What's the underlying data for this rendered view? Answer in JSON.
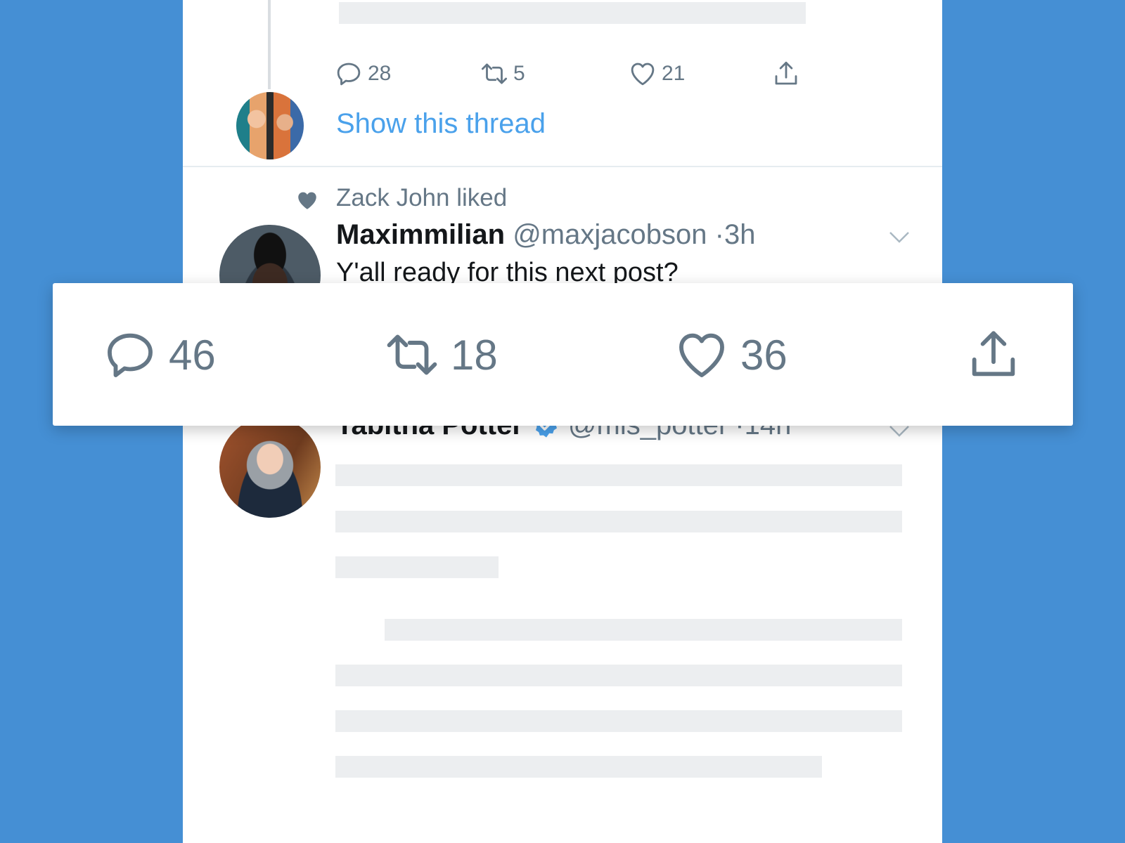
{
  "prev_tweet": {
    "actions": {
      "reply_count": "28",
      "retweet_count": "5",
      "like_count": "21"
    },
    "show_thread": "Show this thread"
  },
  "liked_tweet": {
    "social_context": "Zack John liked",
    "author_name": "Maximmilian",
    "handle": "@maxjacobson",
    "time": "·3h",
    "text": "Y'all ready for this next post?"
  },
  "action_bar": {
    "reply_count": "46",
    "retweet_count": "18",
    "like_count": "36"
  },
  "next_tweet": {
    "author_name": "Tabitha Potter",
    "handle": "@mis_potter",
    "time": "·14h"
  },
  "colors": {
    "background": "#458fd4",
    "link": "#4aa1eb",
    "muted": "#657786",
    "verified": "#4aa1eb"
  },
  "icons": [
    "reply-icon",
    "retweet-icon",
    "like-icon",
    "share-icon",
    "heart-icon",
    "chevron-down-icon",
    "verified-icon"
  ]
}
